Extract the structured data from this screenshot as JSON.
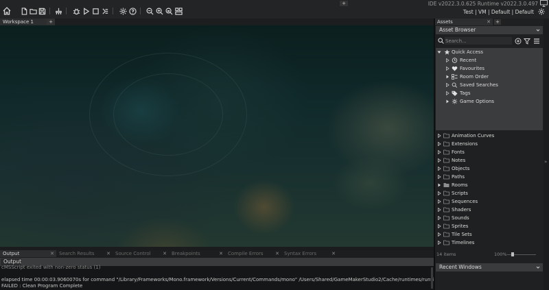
{
  "header": {
    "version_text": "IDE v2022.3.0.625  Runtime v2022.3.0.497",
    "config_text": "Test | VM | Default | Default"
  },
  "toolbar": {
    "buttons": [
      "home-icon",
      "new-file-icon",
      "open-folder-icon",
      "save-icon",
      "clean-icon",
      "debug-icon",
      "run-icon",
      "stop-icon",
      "create-executable-icon",
      "settings-icon",
      "help-icon",
      "zoom-out-icon",
      "zoom-in-icon",
      "zoom-reset-icon",
      "workspace-layout-icon"
    ]
  },
  "workspace": {
    "tab_label": "Workspace 1",
    "add_label": "+"
  },
  "output": {
    "tabs": [
      {
        "label": "Output",
        "active": true
      },
      {
        "label": "Search Results",
        "active": false
      },
      {
        "label": "Source Control",
        "active": false
      },
      {
        "label": "Breakpoints",
        "active": false
      },
      {
        "label": "Compile Errors",
        "active": false
      },
      {
        "label": "Syntax Errors",
        "active": false
      }
    ],
    "add_label": "+",
    "header_label": "Output",
    "lines": [
      "cMSScript exited with non-zero status (1)",
      "elapsed time 00:00:03.9060070s for command \"/Library/Frameworks/Mono.framework/Versions/Current/Commands/mono\" /Users/Shared/GameMakerStudio2/Cache/runtimes/runtime-2022.3.0.497/l",
      "FAILED : Clean Program Complete"
    ]
  },
  "assets": {
    "tab_label": "Assets",
    "add_label": "+",
    "browser_label": "Asset Browser",
    "search_placeholder": "Search...",
    "quick_access": {
      "label": "Quick Access",
      "items": [
        {
          "label": "Recent",
          "icon": "recent-icon",
          "expand": "open"
        },
        {
          "label": "Favourites",
          "icon": "heart-icon",
          "expand": "open"
        },
        {
          "label": "Room Order",
          "icon": "room-order-icon",
          "expand": "filled"
        },
        {
          "label": "Saved Searches",
          "icon": "search-icon",
          "expand": "open"
        },
        {
          "label": "Tags",
          "icon": "tag-icon",
          "expand": "open"
        },
        {
          "label": "Game Options",
          "icon": "game-options-icon",
          "expand": "filled"
        }
      ]
    },
    "folders": [
      {
        "label": "Animation Curves",
        "filled": false
      },
      {
        "label": "Extensions",
        "filled": false
      },
      {
        "label": "Fonts",
        "filled": false
      },
      {
        "label": "Notes",
        "filled": false
      },
      {
        "label": "Objects",
        "filled": false
      },
      {
        "label": "Paths",
        "filled": false
      },
      {
        "label": "Rooms",
        "filled": true
      },
      {
        "label": "Scripts",
        "filled": false
      },
      {
        "label": "Sequences",
        "filled": false
      },
      {
        "label": "Shaders",
        "filled": false
      },
      {
        "label": "Sounds",
        "filled": false
      },
      {
        "label": "Sprites",
        "filled": false
      },
      {
        "label": "Tile Sets",
        "filled": false
      },
      {
        "label": "Timelines",
        "filled": false
      }
    ],
    "items_count": "14 items",
    "zoom_value": "100%",
    "zoom_fraction": 0.2,
    "recent_windows_label": "Recent Windows"
  },
  "colors": {
    "panel": "#1f2021",
    "highlight": "#3b3c3e",
    "text": "#dcdcdc"
  }
}
